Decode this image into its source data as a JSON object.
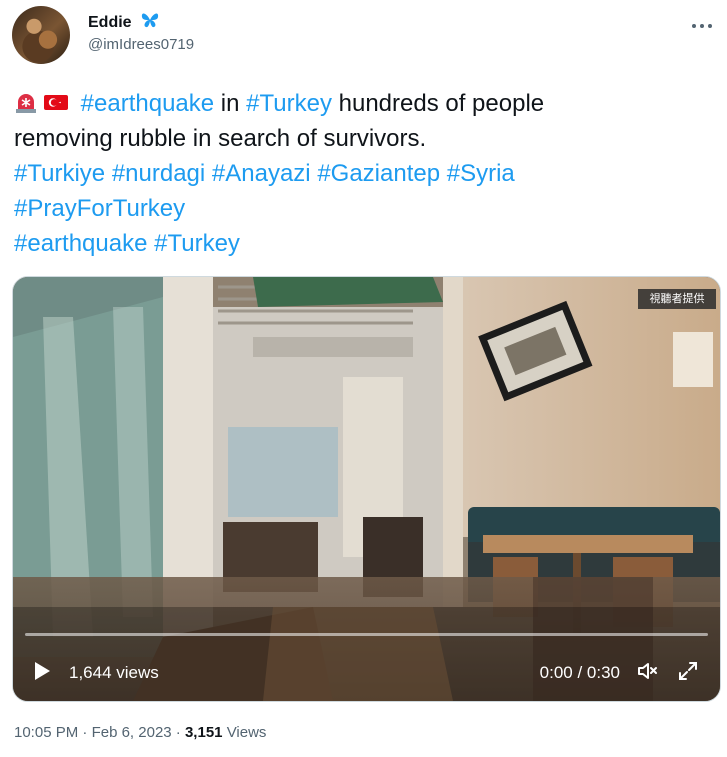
{
  "author": {
    "name": "Eddie",
    "handle": "@imIdrees0719",
    "badge_icon": "butterfly-icon"
  },
  "more_icon": "more-horizontal-icon",
  "tweet": {
    "emojis": [
      "rotating-light-icon",
      "turkey-flag-icon"
    ],
    "line1": {
      "tag1": "#earthquake",
      "mid": " in ",
      "tag2": "#Turkey",
      "rest": " hundreds of people"
    },
    "line2": "removing rubble in search of survivors.",
    "line3": [
      "#Turkiye",
      "#nurdagi",
      "#Anayazi",
      "#Gaziantep",
      "#Syria"
    ],
    "line4": "#PrayForTurkey",
    "line5": [
      "#earthquake",
      "#Turkey"
    ]
  },
  "video": {
    "overlay_views": "1,644 views",
    "time": "0:00 / 0:30",
    "watermark": "視聽者提供",
    "icons": [
      "play-icon",
      "volume-icon",
      "fullscreen-icon"
    ]
  },
  "meta": {
    "time": "10:05 PM",
    "date": "Feb 6, 2023",
    "views_count": "3,151",
    "views_label": "Views"
  },
  "colors": {
    "link": "#1d9bf0",
    "text": "#0f1419",
    "secondary": "#536471"
  }
}
